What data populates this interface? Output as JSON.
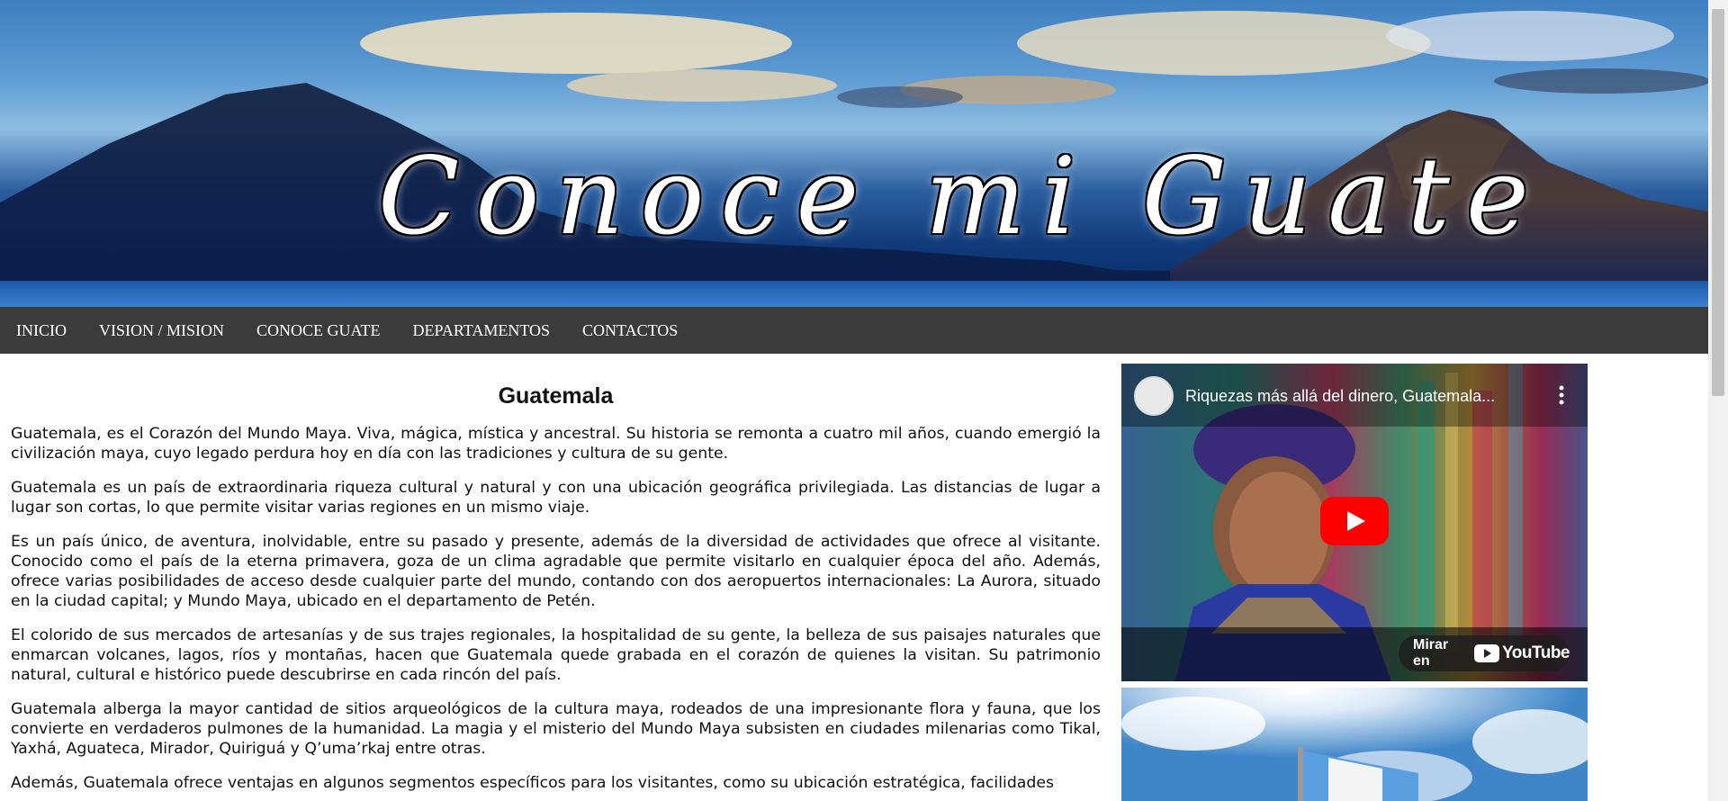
{
  "banner": {
    "title": "Conoce mi Guate"
  },
  "nav": {
    "items": [
      "INICIO",
      "VISION / MISION",
      "CONOCE GUATE",
      "DEPARTAMENTOS",
      "CONTACTOS"
    ]
  },
  "article": {
    "title": "Guatemala",
    "paragraphs": [
      "Guatemala, es el Corazón del Mundo Maya. Viva, mágica, mística y ancestral. Su historia se remonta a cuatro mil años, cuando emergió la civilización maya, cuyo legado perdura hoy en día con las tradiciones y cultura de su gente.",
      "Guatemala es un país de extraordinaria riqueza cultural y natural y con una ubicación geográfica privilegiada. Las distancias de lugar a lugar son cortas, lo que permite visitar varias regiones en un mismo viaje.",
      "Es un país único, de aventura, inolvidable, entre su pasado y presente, además de la diversidad de actividades que ofrece al visitante. Conocido como el país de la eterna primavera, goza de un clima agradable que permite visitarlo en cualquier época del año. Además, ofrece varias posibilidades de acceso desde cualquier parte del mundo, contando con dos aeropuertos internacionales: La Aurora, situado en la ciudad capital; y Mundo Maya, ubicado en el departamento de Petén.",
      "El colorido de sus mercados de artesanías y de sus trajes regionales, la hospitalidad de su gente, la belleza de sus paisajes naturales que enmarcan volcanes, lagos, ríos y montañas, hacen que Guatemala quede grabada en el corazón de quienes la visitan. Su patrimonio natural, cultural e histórico puede descubrirse en cada rincón del país.",
      "Guatemala alberga la mayor cantidad de sitios arqueológicos de la cultura maya, rodeados de una impresionante flora y fauna, que los convierte en verdaderos pulmones de la humanidad. La magia y el misterio del Mundo Maya subsisten en ciudades milenarias como Tikal, Yaxhá, Aguateca, Mirador, Quiriguá y Q’uma’rkaj entre otras.",
      "Además, Guatemala ofrece ventajas en algunos segmentos específicos para los visitantes, como su ubicación estratégica, facilidades"
    ]
  },
  "video": {
    "title": "Riquezas más allá del dinero, Guatemala...",
    "watch_label": "Mirar en",
    "brand": "YouTube",
    "icons": {
      "play": "play-icon",
      "menu": "more-vert-icon",
      "channel": "channel-avatar"
    }
  },
  "colors": {
    "nav_bg": "#3b3b3b",
    "youtube_red": "#ff0000",
    "text": "#111111"
  }
}
